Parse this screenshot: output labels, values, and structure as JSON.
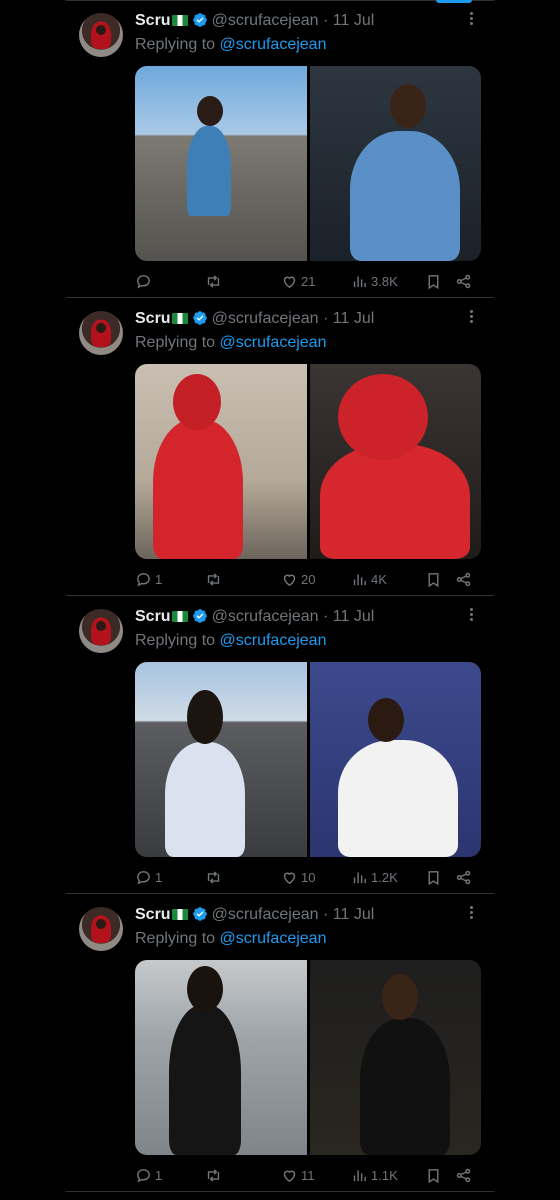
{
  "colors": {
    "background": "#000000",
    "text_primary": "#e7e9ea",
    "text_secondary": "#71767b",
    "accent": "#1d9bf0",
    "divider": "#2f3336"
  },
  "tweets": [
    {
      "name": "Scru",
      "flag_icon": "nigeria-flag-icon",
      "verified_icon": "verified-badge-icon",
      "handle": "@scrufacejean",
      "dot": "·",
      "date": "11 Jul",
      "replying_prefix": "Replying to",
      "replying_handle": "@scrufacejean",
      "reply_count": "",
      "like_count": "21",
      "view_count": "3.8K"
    },
    {
      "name": "Scru",
      "flag_icon": "nigeria-flag-icon",
      "verified_icon": "verified-badge-icon",
      "handle": "@scrufacejean",
      "dot": "·",
      "date": "11 Jul",
      "replying_prefix": "Replying to",
      "replying_handle": "@scrufacejean",
      "reply_count": "1",
      "like_count": "20",
      "view_count": "4K"
    },
    {
      "name": "Scru",
      "flag_icon": "nigeria-flag-icon",
      "verified_icon": "verified-badge-icon",
      "handle": "@scrufacejean",
      "dot": "·",
      "date": "11 Jul",
      "replying_prefix": "Replying to",
      "replying_handle": "@scrufacejean",
      "reply_count": "1",
      "like_count": "10",
      "view_count": "1.2K"
    },
    {
      "name": "Scru",
      "flag_icon": "nigeria-flag-icon",
      "verified_icon": "verified-badge-icon",
      "handle": "@scrufacejean",
      "dot": "·",
      "date": "11 Jul",
      "replying_prefix": "Replying to",
      "replying_handle": "@scrufacejean",
      "reply_count": "1",
      "like_count": "11",
      "view_count": "1.1K"
    }
  ]
}
